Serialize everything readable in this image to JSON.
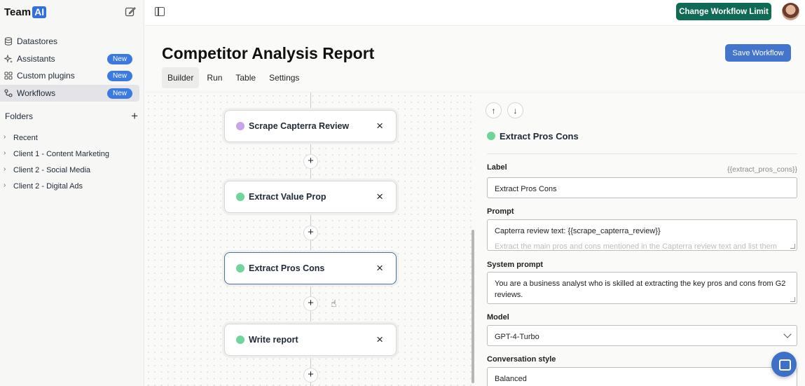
{
  "brand": {
    "name": "Team",
    "ai": "AI"
  },
  "sidebar": {
    "items": [
      {
        "label": "Datastores",
        "badge": ""
      },
      {
        "label": "Assistants",
        "badge": "New"
      },
      {
        "label": "Custom plugins",
        "badge": "New"
      },
      {
        "label": "Workflows",
        "badge": "New"
      }
    ],
    "folders_heading": "Folders",
    "folders": [
      "Recent",
      "Client 1 - Content Marketing",
      "Client 2 - Social Media",
      "Client 2 - Digital Ads"
    ]
  },
  "header": {
    "limit_button": "Change Workflow Limit"
  },
  "page": {
    "title": "Competitor Analysis Report",
    "save_button": "Save Workflow",
    "tabs": [
      "Builder",
      "Run",
      "Table",
      "Settings"
    ]
  },
  "nodes": [
    {
      "label": "Scrape Capterra Review",
      "color": "#c9a4ea"
    },
    {
      "label": "Extract Value Prop",
      "color": "#6fd69a"
    },
    {
      "label": "Extract Pros Cons",
      "color": "#6fd69a"
    },
    {
      "label": "Write report",
      "color": "#6fd69a"
    }
  ],
  "icons": {
    "close": "×",
    "plus": "+",
    "up": "↑",
    "down": "↓",
    "chevron": "›"
  },
  "panel": {
    "title": "Extract Pros Cons",
    "label_field": {
      "label": "Label",
      "variable": "{{extract_pros_cons}}",
      "value": "Extract Pros Cons"
    },
    "prompt_field": {
      "label": "Prompt",
      "value": "Capterra review text: {{scrape_capterra_review}}",
      "overflow": "Extract the main pros and cons mentioned in the Capterra review text and list them"
    },
    "system_field": {
      "label": "System prompt",
      "value": "You are a business analyst who is skilled at extracting the key pros and cons from G2 reviews."
    },
    "model_field": {
      "label": "Model",
      "value": "GPT-4-Turbo"
    },
    "style_field": {
      "label": "Conversation style",
      "value": "Balanced"
    }
  }
}
